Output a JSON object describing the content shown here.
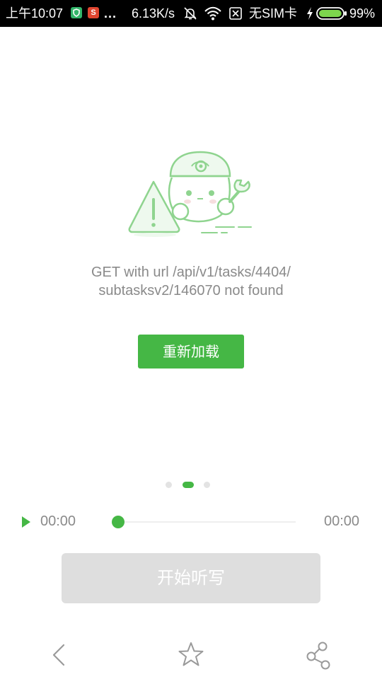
{
  "status_bar": {
    "time": "上午10:07",
    "badge_s": "S",
    "more": "...",
    "net_speed": "6.13K/s",
    "sim": "无SIM卡",
    "battery_percent": "99%",
    "battery_level": 0.99,
    "icons": [
      "shield-icon",
      "s-app-icon",
      "bell-muted-icon",
      "wifi-icon",
      "no-sim-icon",
      "charging-icon",
      "battery-icon"
    ]
  },
  "error": {
    "illustration": "robot-warning-illustration",
    "message_line1": "GET with url /api/v1/tasks/4404/",
    "message_line2": "subtasksv2/146070 not found"
  },
  "reload_button": {
    "label": "重新加载"
  },
  "pager": {
    "count": 3,
    "active_index": 1
  },
  "player": {
    "current_time": "00:00",
    "total_time": "00:00",
    "progress": 0.0
  },
  "start_button": {
    "label": "开始听写",
    "enabled": false
  },
  "bottom_bar": {
    "icons": [
      "back-icon",
      "star-icon",
      "share-icon"
    ]
  },
  "colors": {
    "accent": "#45b745",
    "status_bar_bg": "#000000",
    "text_muted": "#8a8a8a",
    "disabled_button": "#dedede",
    "illustration_line": "#8fd48f",
    "illustration_fill": "#eef9ee"
  }
}
